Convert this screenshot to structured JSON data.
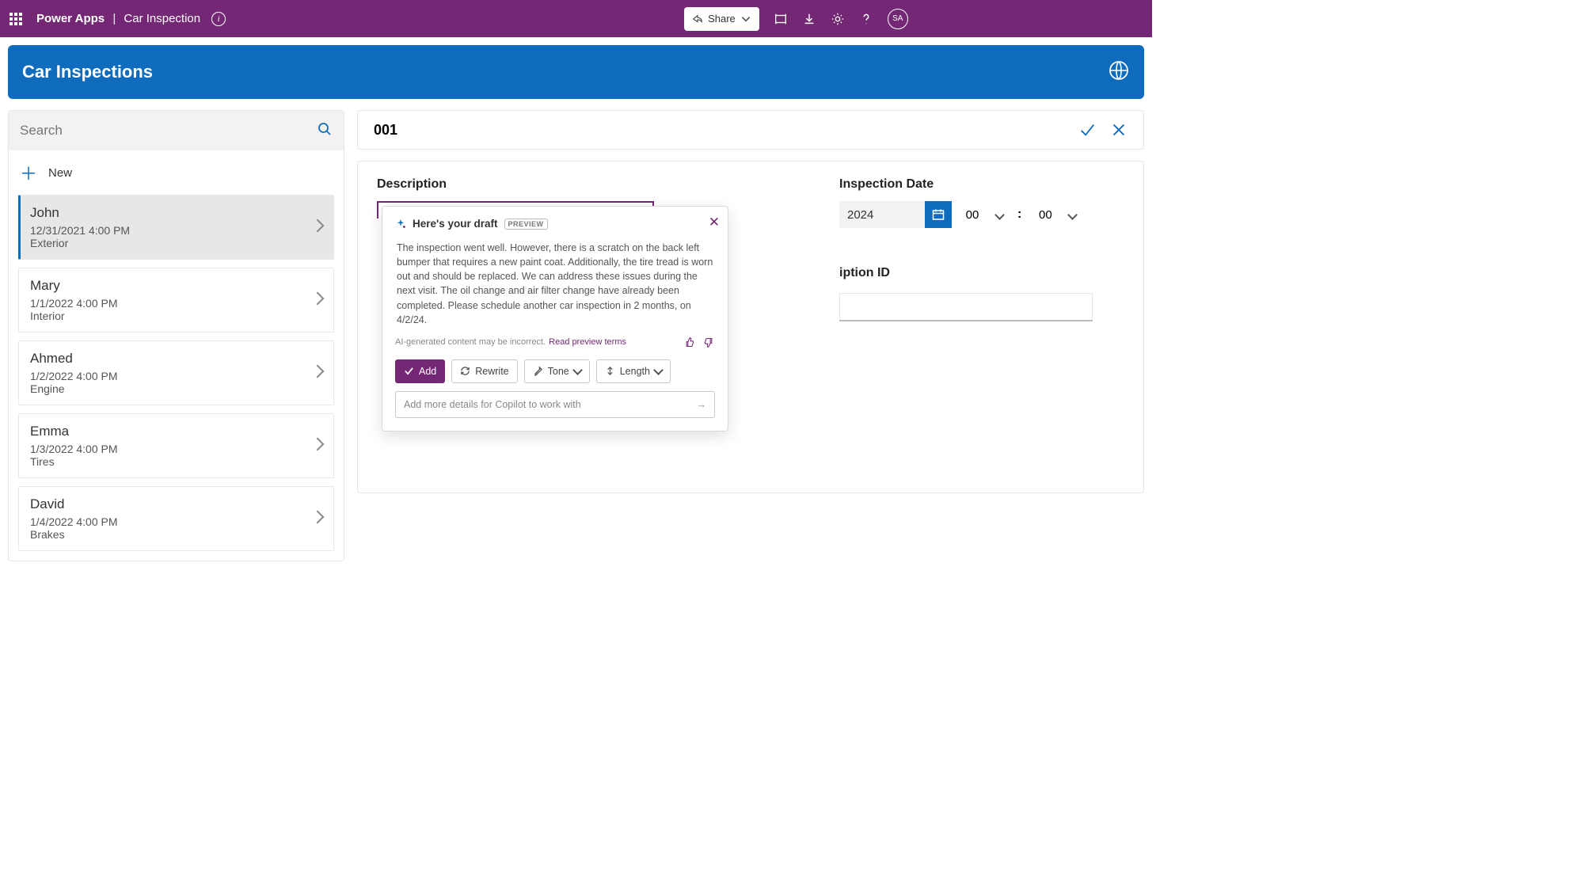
{
  "topbar": {
    "product": "Power Apps",
    "app": "Car Inspection",
    "share": "Share",
    "avatar": "SA"
  },
  "header": {
    "title": "Car Inspections"
  },
  "search": {
    "placeholder": "Search"
  },
  "new_label": "New",
  "items": [
    {
      "name": "John",
      "date": "12/31/2021 4:00 PM",
      "type": "Exterior",
      "selected": true
    },
    {
      "name": "Mary",
      "date": "1/1/2022 4:00 PM",
      "type": "Interior"
    },
    {
      "name": "Ahmed",
      "date": "1/2/2022 4:00 PM",
      "type": "Engine"
    },
    {
      "name": "Emma",
      "date": "1/3/2022 4:00 PM",
      "type": "Tires"
    },
    {
      "name": "David",
      "date": "1/4/2022 4:00 PM",
      "type": "Brakes"
    }
  ],
  "detail": {
    "id": "001",
    "labels": {
      "description": "Description",
      "inspection_date": "Inspection Date",
      "iption_id": "iption ID"
    },
    "date": {
      "year_fragment": "2024",
      "hour": "00",
      "minute": "00",
      "colon": ":"
    }
  },
  "copilot": {
    "title": "Here's your draft",
    "badge": "PREVIEW",
    "draft": "The inspection went well. However, there is a scratch on the back left bumper that requires a new paint coat. Additionally, the tire tread is worn out and should be replaced. We can address these issues during the next visit. The oil change and air filter change have already been completed. Please schedule another car inspection in 2 months, on 4/2/24.",
    "disclaimer": "AI-generated content may be incorrect.",
    "terms": "Read preview terms",
    "buttons": {
      "add": "Add",
      "rewrite": "Rewrite",
      "tone": "Tone",
      "length": "Length"
    },
    "more_placeholder": "Add more details for Copilot to work with"
  }
}
